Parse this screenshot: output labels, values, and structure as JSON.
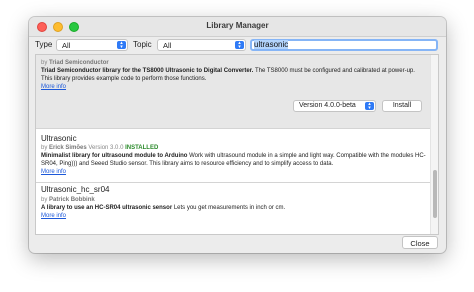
{
  "window": {
    "title": "Library Manager"
  },
  "filters": {
    "type_label": "Type",
    "type_value": "All",
    "topic_label": "Topic",
    "topic_value": "All",
    "search_value": "ultrasonic"
  },
  "libraries": [
    {
      "title": "",
      "by": "by",
      "author": "Triad Semiconductor",
      "description_bold": "Triad Semiconductor library for the TS8000 Ultrasonic to Digital Converter.",
      "description_rest": " The TS8000 must be configured and calibrated at power-up. This library provides example code to perform those functions.",
      "more_info": "More info",
      "version_select": "Version 4.0.0-beta",
      "install_label": "Install"
    },
    {
      "title": "Ultrasonic",
      "by": "by",
      "author": "Erick Simões",
      "version_text": "Version 3.0.0",
      "installed_label": "INSTALLED",
      "description_bold": "Minimalist library for ultrasound module to Arduino",
      "description_rest": " Work with ultrasound module in a simple and light way. Compatible with the modules HC-SR04, Ping))) and Seeed Studio sensor. This library aims to resource efficiency and to simplify access to data.",
      "more_info": "More info"
    },
    {
      "title": "Ultrasonic_hc_sr04",
      "by": "by",
      "author": "Patrick Bobbink",
      "description_bold": "A library to use an HC-SR04 ultrasonic sensor",
      "description_rest": " Lets you get measurements in inch or cm.",
      "more_info": "More info"
    }
  ],
  "footer": {
    "close_label": "Close"
  },
  "colors": {
    "accent": "#2f7af6",
    "installed": "#2a8a2a",
    "link": "#1c58d9",
    "close": "#fe5f57",
    "minimize": "#febc2e",
    "maximize": "#28c840"
  }
}
